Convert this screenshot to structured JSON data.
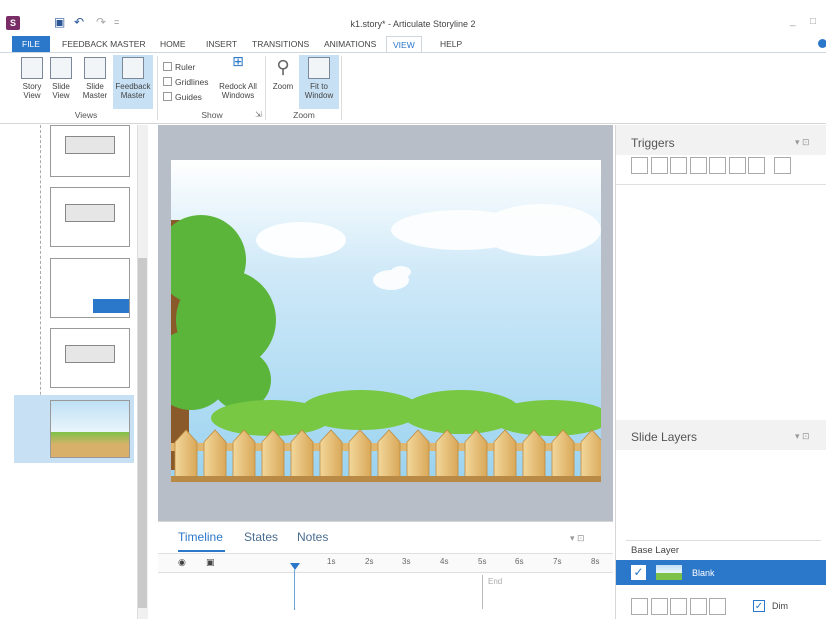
{
  "window": {
    "title": "k1.story* - Articulate Storyline 2",
    "minimize": "_",
    "restore": "□"
  },
  "menu": [
    "FILE",
    "FEEDBACK MASTER",
    "HOME",
    "INSERT",
    "TRANSITIONS",
    "ANIMATIONS",
    "VIEW",
    "HELP"
  ],
  "ribbon": {
    "views": {
      "story_view": [
        "Story",
        "View"
      ],
      "slide_view": [
        "Slide",
        "View"
      ],
      "slide_master": [
        "Slide",
        "Master"
      ],
      "feedback_master": [
        "Feedback",
        "Master"
      ],
      "group": "Views"
    },
    "show": {
      "ruler": "Ruler",
      "gridlines": "Gridlines",
      "guides": "Guides",
      "redock": [
        "Redock All",
        "Windows"
      ],
      "group": "Show"
    },
    "zoom": {
      "zoom": "Zoom",
      "fit": [
        "Fit to",
        "Window"
      ],
      "group": "Zoom"
    }
  },
  "timeline": {
    "tabs": [
      "Timeline",
      "States",
      "Notes"
    ],
    "ticks": [
      "1s",
      "2s",
      "3s",
      "4s",
      "5s",
      "6s",
      "7s",
      "8s"
    ],
    "end_label": "End"
  },
  "right": {
    "triggers_title": "Triggers",
    "layers_title": "Slide Layers",
    "base_layer": "Base Layer",
    "layer_name": "Blank",
    "dim_label": "Dim"
  },
  "colors": {
    "accent": "#2b77c9",
    "selection": "#c7e0f4",
    "canvas_bg": "#b7bec7"
  }
}
